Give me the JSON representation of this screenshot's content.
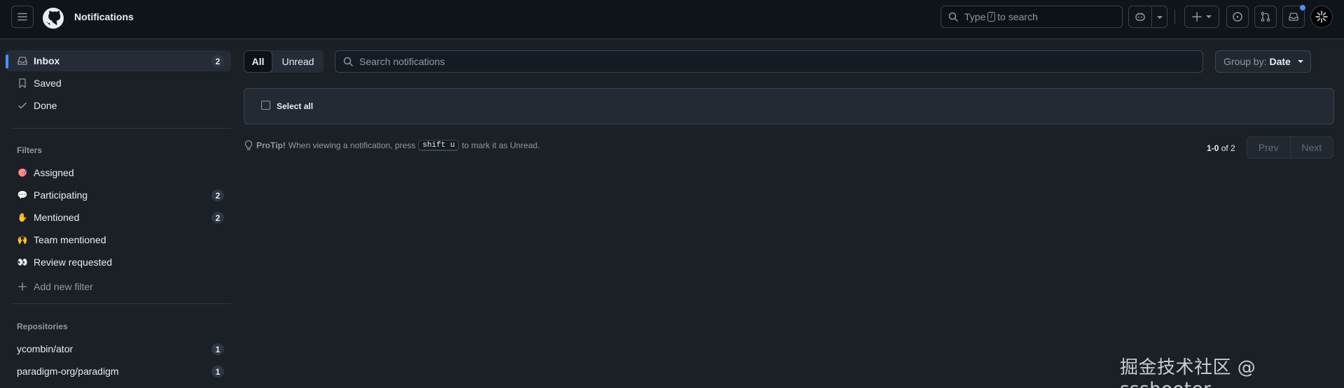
{
  "header": {
    "title": "Notifications",
    "search_prefix": "Type",
    "search_key": "/",
    "search_suffix": "to search",
    "icons": [
      "menu-icon",
      "github-logo-icon",
      "search-icon",
      "copilot-icon",
      "plus-icon",
      "issues-icon",
      "pull-requests-icon",
      "inbox-icon"
    ]
  },
  "sidebar": {
    "main_items": [
      {
        "label": "Inbox",
        "count": "2",
        "icon": "inbox-icon"
      },
      {
        "label": "Saved",
        "icon": "bookmark-icon"
      },
      {
        "label": "Done",
        "icon": "check-icon"
      }
    ],
    "filters_heading": "Filters",
    "filters": [
      {
        "emoji": "🎯",
        "label": "Assigned"
      },
      {
        "emoji": "💬",
        "label": "Participating",
        "count": "2"
      },
      {
        "emoji": "✋",
        "label": "Mentioned",
        "count": "2"
      },
      {
        "emoji": "🙌",
        "label": "Team mentioned"
      },
      {
        "emoji": "👀",
        "label": "Review requested"
      }
    ],
    "add_filter": "Add new filter",
    "repos_heading": "Repositories",
    "repos": [
      {
        "label": "ycombin/ator",
        "count": "1"
      },
      {
        "label": "paradigm-org/paradigm",
        "count": "1"
      }
    ]
  },
  "main": {
    "tab_all": "All",
    "tab_unread": "Unread",
    "search_placeholder": "Search notifications",
    "groupby_label": "Group by:",
    "groupby_value": "Date",
    "select_all": "Select all",
    "protip_label": "ProTip!",
    "protip_text_1": "When viewing a notification, press",
    "protip_key": "shift u",
    "protip_text_2": "to mark it as Unread.",
    "pager_range": "1-0",
    "pager_of": "of 2",
    "prev": "Prev",
    "next": "Next"
  },
  "watermark": "掘金技术社区 @ ssshooter",
  "colors": {
    "accent": "#4493f8",
    "bg": "#1b1f26",
    "topbar": "#0f131a"
  }
}
